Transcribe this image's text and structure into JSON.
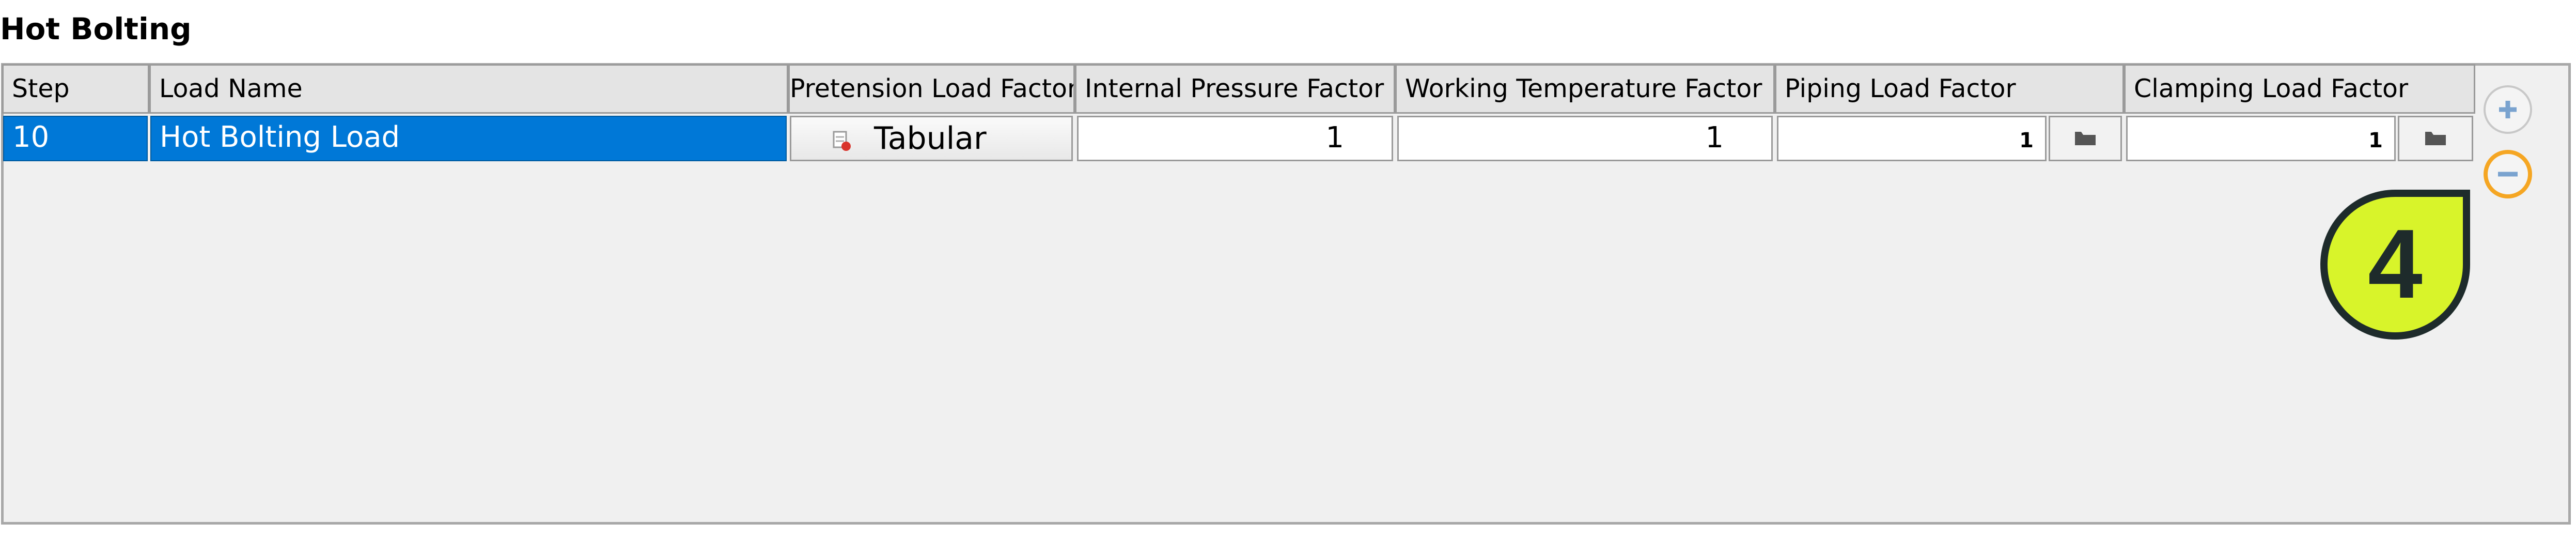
{
  "section_title": "Hot Bolting",
  "table": {
    "columns": [
      "Step",
      "Load Name",
      "Pretension Load Factor",
      "Internal Pressure Factor",
      "Working Temperature Factor",
      "Piping Load Factor",
      "Clamping Load Factor"
    ],
    "rows": [
      {
        "step": "10",
        "load_name": "Hot Bolting Load",
        "pretension_load_factor": "Tabular",
        "internal_pressure_factor": "1",
        "working_temperature_factor": "1",
        "piping_load_factor": "1",
        "clamping_load_factor": "1"
      }
    ]
  },
  "icons": {
    "add": "plus-icon",
    "remove": "minus-icon",
    "tabular": "tabular-icon",
    "browse": "folder-icon"
  },
  "callout": {
    "number": "4",
    "fill_color": "#d8f42a",
    "highlight_color": "#f5a623"
  },
  "colors": {
    "selection": "#0078d7",
    "panel": "#f0f0f0"
  }
}
